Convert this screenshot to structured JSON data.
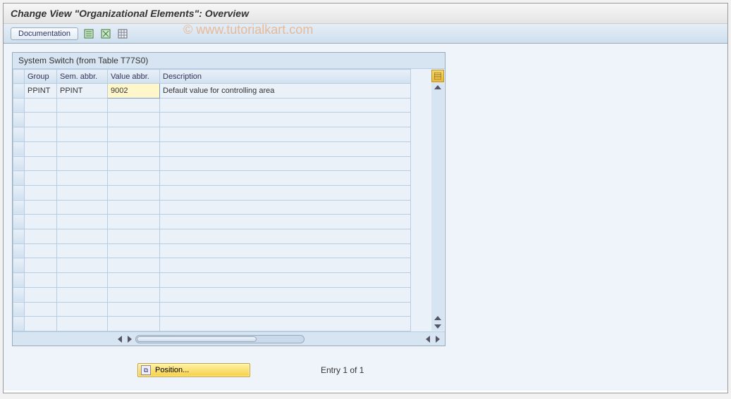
{
  "window": {
    "title": "Change View \"Organizational Elements\": Overview"
  },
  "watermark": "© www.tutorialkart.com",
  "toolbar": {
    "documentation_label": "Documentation"
  },
  "table": {
    "caption": "System Switch (from Table T77S0)",
    "columns": {
      "group": "Group",
      "sem": "Sem. abbr.",
      "value": "Value abbr.",
      "desc": "Description"
    },
    "rows": [
      {
        "group": "PPINT",
        "sem": "PPINT",
        "value": "9002",
        "desc": "Default value for controlling area"
      }
    ],
    "blank_rows": 16
  },
  "footer": {
    "position_label": "Position...",
    "entry_text": "Entry 1 of 1"
  }
}
